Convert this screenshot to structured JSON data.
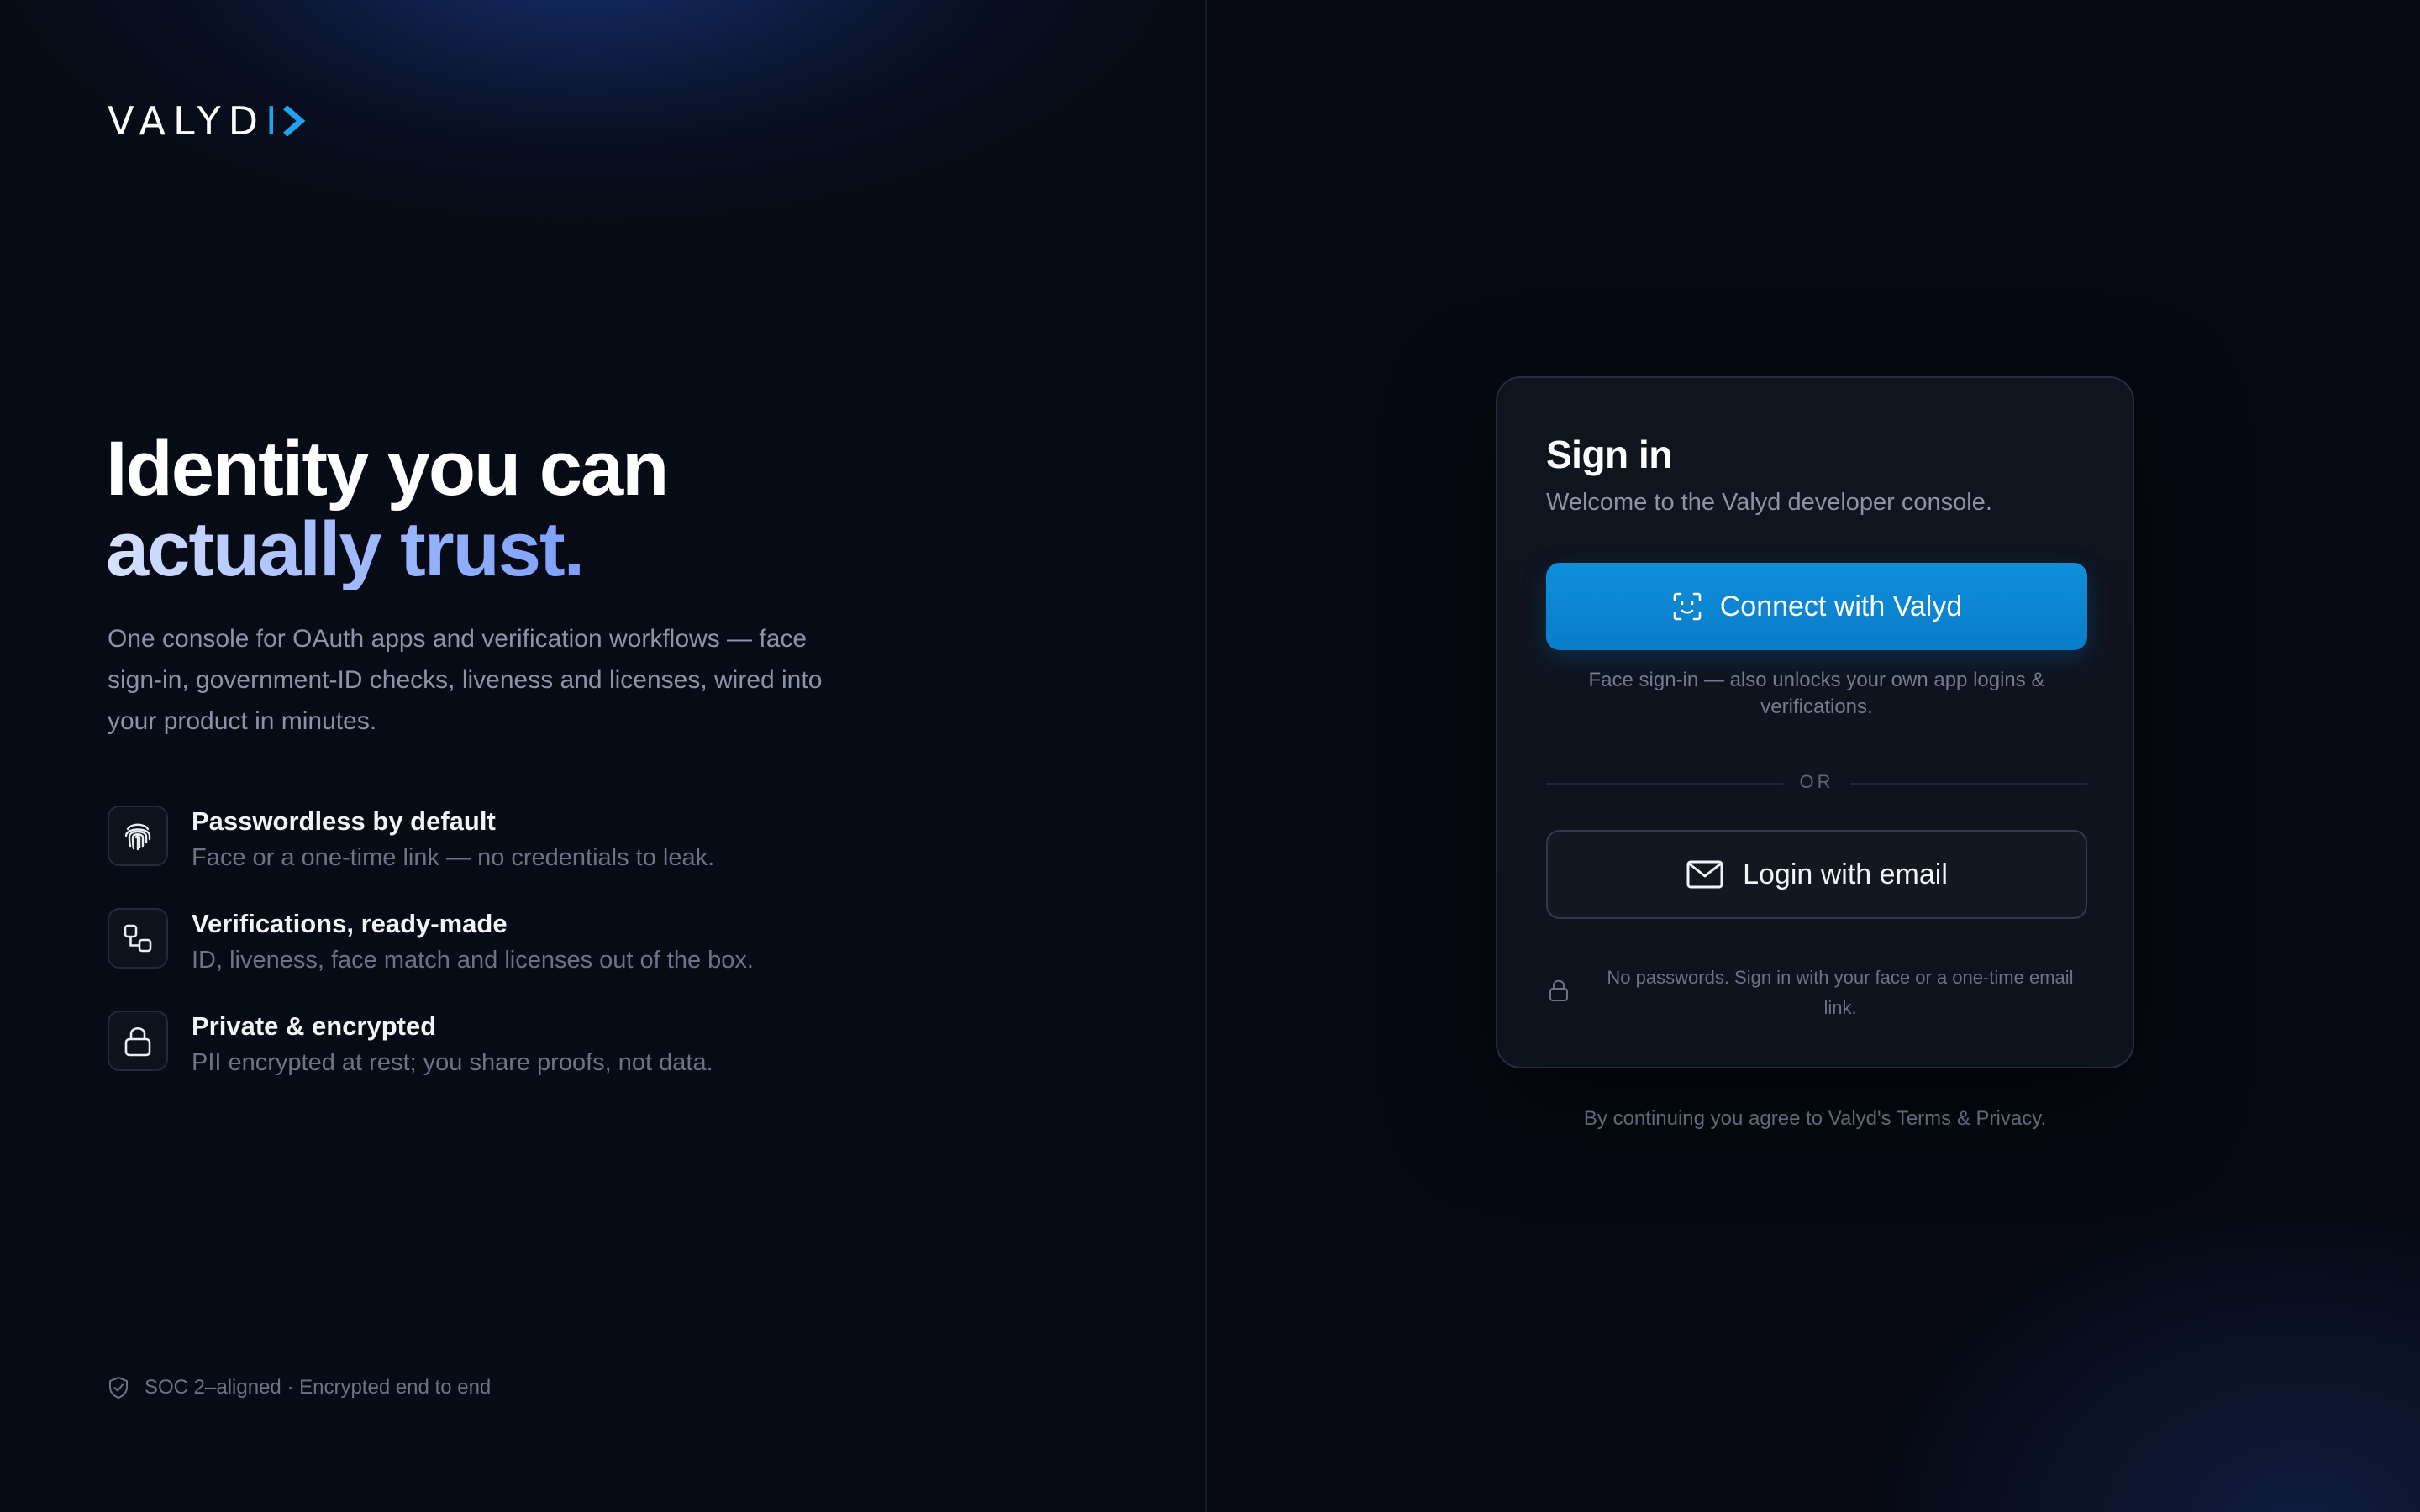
{
  "brand": {
    "logo_text": "VALYD",
    "logo_accent": "I",
    "accent_color": "#1fa3ee"
  },
  "hero": {
    "headline_line1": "Identity you can",
    "headline_line2": "actually trust.",
    "lede": "One console for OAuth apps and verification workflows — face sign-in, government-ID checks, liveness and licenses, wired into your product in minutes."
  },
  "features": [
    {
      "icon": "fingerprint-icon",
      "title": "Passwordless by default",
      "desc": "Face or a one-time link — no credentials to leak."
    },
    {
      "icon": "workflow-icon",
      "title": "Verifications, ready-made",
      "desc": "ID, liveness, face match and licenses out of the box."
    },
    {
      "icon": "lock-icon",
      "title": "Private & encrypted",
      "desc": "PII encrypted at rest; you share proofs, not data."
    }
  ],
  "trust_note": "SOC 2–aligned · Encrypted end to end",
  "signin": {
    "title": "Sign in",
    "welcome": "Welcome to the Valyd developer console.",
    "primary_button": "Connect with Valyd",
    "face_note": "Face sign-in — also unlocks your own app logins & verifications.",
    "divider": "OR",
    "email_button": "Login with email",
    "no_password_note": "No passwords. Sign in with your face or a one-time email link.",
    "primary_color": "#0a7cc8"
  },
  "terms": "By continuing you agree to Valyd's Terms & Privacy."
}
